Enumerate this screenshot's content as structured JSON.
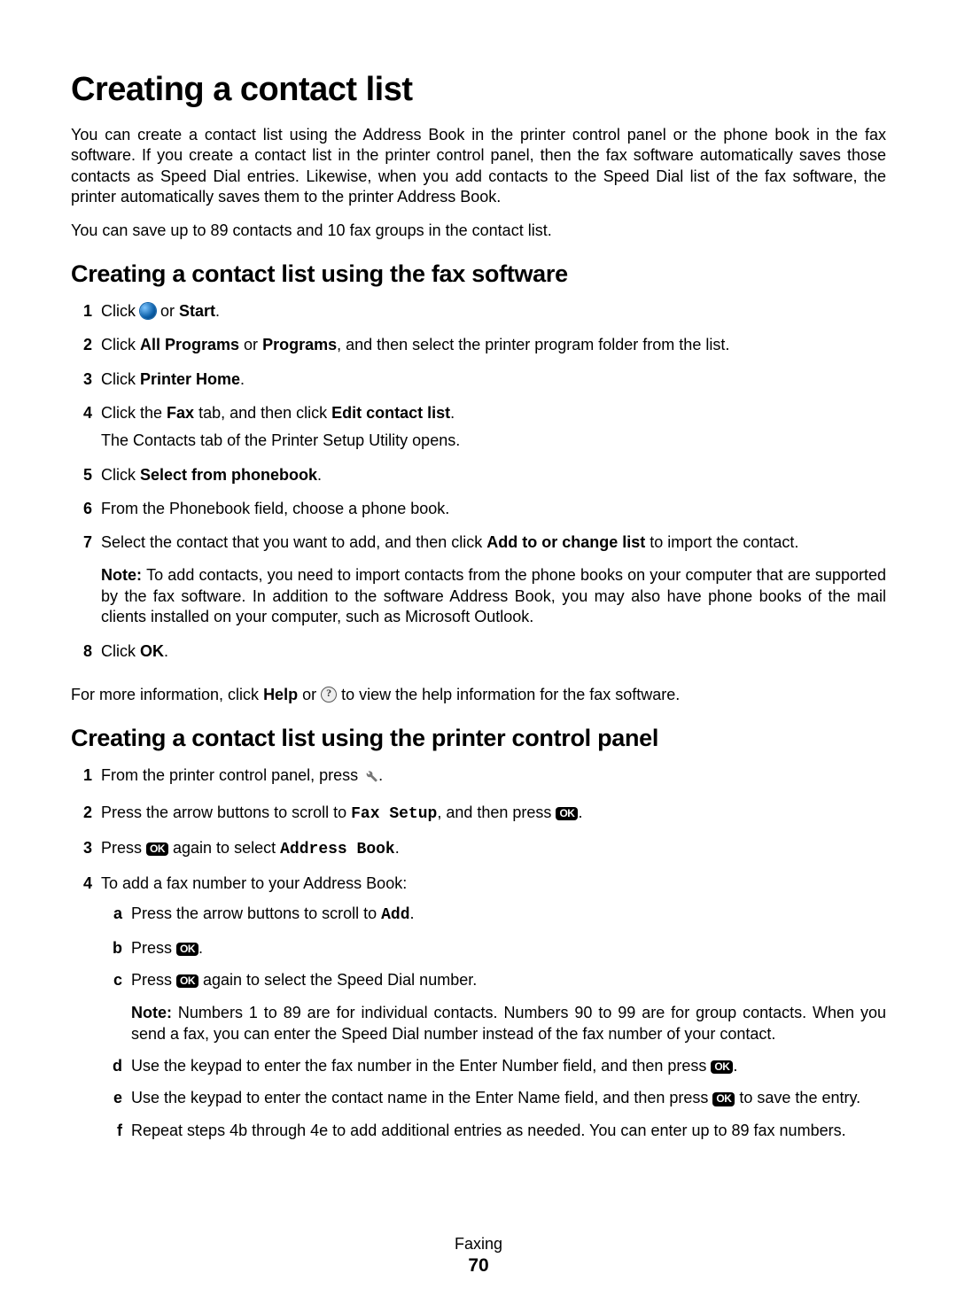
{
  "title": "Creating a contact list",
  "intro1": "You can create a contact list using the Address Book in the printer control panel or the phone book in the fax software. If you create a contact list in the printer control panel, then the fax software automatically saves those contacts as Speed Dial entries. Likewise, when you add contacts to the Speed Dial list of the fax software, the printer automatically saves them to the printer Address Book.",
  "intro2": "You can save up to 89 contacts and 10 fax groups in the contact list.",
  "sec1": {
    "heading": "Creating a contact list using the fax software",
    "step1_pre": "Click ",
    "step1_post": " or ",
    "step1_bold": "Start",
    "step2_a": "Click ",
    "step2_b1": "All Programs",
    "step2_c": " or ",
    "step2_b2": "Programs",
    "step2_d": ", and then select the printer program folder from the list.",
    "step3_a": "Click ",
    "step3_b": "Printer Home",
    "step4_a": "Click the ",
    "step4_b1": "Fax",
    "step4_c": " tab, and then click ",
    "step4_b2": "Edit contact list",
    "step4_sub": "The Contacts tab of the Printer Setup Utility opens.",
    "step5_a": "Click ",
    "step5_b": "Select from phonebook",
    "step6": "From the Phonebook field, choose a phone book.",
    "step7_a": "Select the contact that you want to add, and then click ",
    "step7_b": "Add to or change list",
    "step7_c": " to import the contact.",
    "step7_note_label": "Note: ",
    "step7_note": "To add contacts, you need to import contacts from the phone books on your computer that are supported by the fax software. In addition to the software Address Book, you may also have phone books of the mail clients installed on your computer, such as Microsoft Outlook.",
    "step8_a": "Click ",
    "step8_b": "OK",
    "outro_a": "For more information, click ",
    "outro_b": "Help",
    "outro_c": " or ",
    "outro_d": " to view the help information for the fax software."
  },
  "sec2": {
    "heading": "Creating a contact list using the printer control panel",
    "step1_a": "From the printer control panel, press ",
    "step2_a": "Press the arrow buttons to scroll to ",
    "step2_mono": "Fax Setup",
    "step2_b": ", and then press ",
    "step3_a": "Press ",
    "step3_b": " again to select ",
    "step3_mono": "Address Book",
    "step4_intro": "To add a fax number to your Address Book:",
    "sub_a_a": "Press the arrow buttons to scroll to ",
    "sub_a_mono": "Add",
    "sub_b_a": "Press ",
    "sub_c_a": "Press ",
    "sub_c_b": " again to select the Speed Dial number.",
    "sub_c_note_label": "Note: ",
    "sub_c_note": "Numbers 1 to 89 are for individual contacts. Numbers 90 to 99 are for group contacts. When you send a fax, you can enter the Speed Dial number instead of the fax number of your contact.",
    "sub_d_a": "Use the keypad to enter the fax number in the Enter Number field, and then press ",
    "sub_e_a": "Use the keypad to enter the contact name in the Enter Name field, and then press ",
    "sub_e_b": " to save the entry.",
    "sub_f": "Repeat steps 4b through 4e to add additional entries as needed. You can enter up to 89 fax numbers."
  },
  "ok_label": "OK",
  "footer": {
    "chapter": "Faxing",
    "page": "70"
  }
}
